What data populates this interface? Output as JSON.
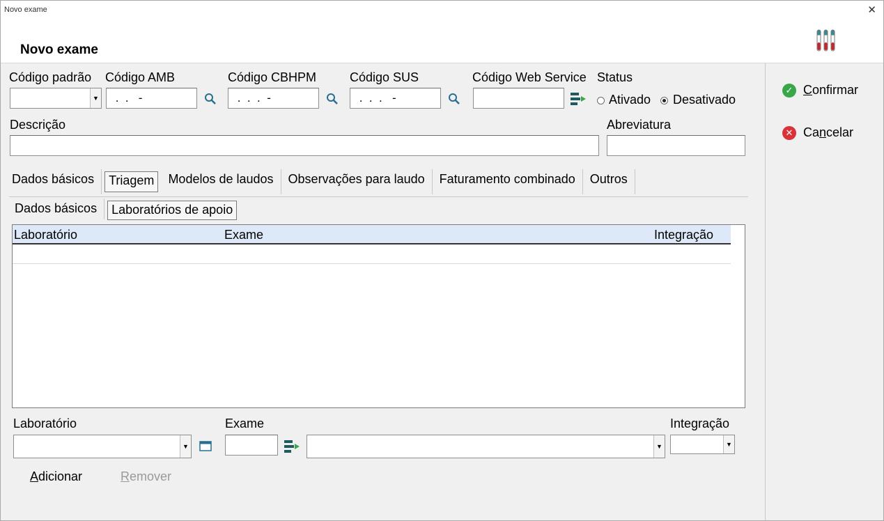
{
  "window": {
    "title": "Novo exame"
  },
  "header": {
    "title": "Novo exame"
  },
  "fields": {
    "codigo_padrao": {
      "label": "Código padrão",
      "value": ""
    },
    "codigo_amb": {
      "label": "Código AMB",
      "value": " .  .   -"
    },
    "codigo_cbhpm": {
      "label": "Código CBHPM",
      "value": " .  .  .  -"
    },
    "codigo_sus": {
      "label": "Código SUS",
      "value": " .  .  .   -"
    },
    "codigo_ws": {
      "label": "Código Web Service",
      "value": ""
    },
    "status": {
      "label": "Status",
      "options": [
        "Ativado",
        "Desativado"
      ],
      "selected": "Desativado"
    },
    "descricao": {
      "label": "Descrição",
      "value": ""
    },
    "abreviatura": {
      "label": "Abreviatura",
      "value": ""
    }
  },
  "tabs": [
    {
      "label": "Dados básicos"
    },
    {
      "label": "Triagem",
      "selected": true
    },
    {
      "label": "Modelos de laudos"
    },
    {
      "label": "Observações para laudo"
    },
    {
      "label": "Faturamento combinado"
    },
    {
      "label": "Outros"
    }
  ],
  "subtabs": [
    {
      "label": "Dados básicos"
    },
    {
      "label": "Laboratórios de apoio",
      "selected": true
    }
  ],
  "grid": {
    "columns": [
      "Laboratório",
      "Exame",
      "Integração"
    ],
    "rows": []
  },
  "bottom": {
    "laboratorio_label": "Laboratório",
    "exame_label": "Exame",
    "integracao_label": "Integração",
    "adicionar": {
      "first": "A",
      "rest": "dicionar"
    },
    "remover": {
      "first": "R",
      "rest": "emover"
    }
  },
  "side": {
    "confirmar": {
      "first": "C",
      "rest": "onfirmar"
    },
    "cancelar": {
      "pre": "Ca",
      "u": "n",
      "rest": "celar"
    }
  },
  "colors": {
    "confirm": "#3aa64a",
    "cancel": "#d93339",
    "grid_header": "#dde9f9"
  }
}
